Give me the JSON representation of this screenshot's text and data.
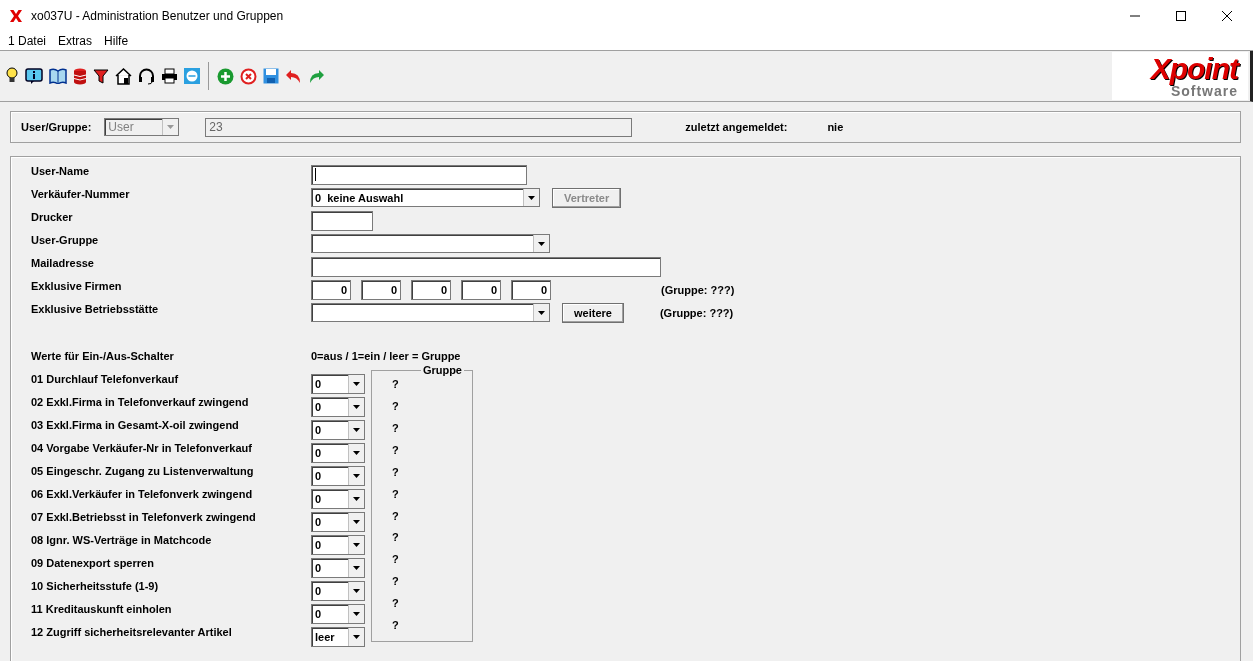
{
  "window": {
    "title": "xo037U - Administration Benutzer und Gruppen"
  },
  "menu": [
    "1 Datei",
    "Extras",
    "Hilfe"
  ],
  "logo": {
    "brand": "Xpoint",
    "sub": "Software"
  },
  "header": {
    "label": "User/Gruppe:",
    "type": {
      "value": "User",
      "disabled": true
    },
    "id": "23",
    "login_label": "zuletzt angemeldet:",
    "login_value": "nie"
  },
  "fields": [
    {
      "label": "User-Name",
      "kind": "name"
    },
    {
      "label": "Verkäufer-Nummer",
      "kind": "select-button",
      "value": "0  keine Auswahl",
      "button": {
        "label": "Vertreter",
        "disabled": true
      }
    },
    {
      "label": "Drucker",
      "kind": "short"
    },
    {
      "label": "User-Gruppe",
      "kind": "select"
    },
    {
      "label": "Mailadresse",
      "kind": "mail"
    },
    {
      "label": "Exklusive Firmen",
      "kind": "numbers",
      "values": [
        "0",
        "0",
        "0",
        "0",
        "0"
      ],
      "note": "(Gruppe:  ???)"
    },
    {
      "label": "Exklusive Betriebsstätte",
      "kind": "select-button",
      "button": {
        "label": "weitere",
        "disabled": false
      },
      "note": "(Gruppe:  ???)"
    }
  ],
  "switches": {
    "title": "Werte für Ein-/Aus-Schalter",
    "legend": "0=aus / 1=ein / leer = Gruppe",
    "group_title": "Gruppe",
    "items": [
      {
        "label": "01 Durchlauf Telefonverkauf",
        "value": "0",
        "group": "?"
      },
      {
        "label": "02 Exkl.Firma in Telefonverkauf zwingend",
        "value": "0",
        "group": "?"
      },
      {
        "label": "03 Exkl.Firma in Gesamt-X-oil zwingend",
        "value": "0",
        "group": "?"
      },
      {
        "label": "04 Vorgabe Verkäufer-Nr in Telefonverkauf",
        "value": "0",
        "group": "?"
      },
      {
        "label": "05 Eingeschr. Zugang zu Listenverwaltung",
        "value": "0",
        "group": "?"
      },
      {
        "label": "06 Exkl.Verkäufer in Telefonverk zwingend",
        "value": "0",
        "group": "?"
      },
      {
        "label": "07 Exkl.Betriebsst in Telefonverk zwingend",
        "value": "0",
        "group": "?"
      },
      {
        "label": "08 Ignr. WS-Verträge in Matchcode",
        "value": "0",
        "group": "?"
      },
      {
        "label": "09 Datenexport sperren",
        "value": "0",
        "group": "?"
      },
      {
        "label": "10 Sicherheitsstufe (1-9)",
        "value": "0",
        "group": "?"
      },
      {
        "label": "11 Kreditauskunft einholen",
        "value": "0",
        "group": "?"
      },
      {
        "label": "12 Zugriff sicherheitsrelevanter Artikel",
        "value": "leer",
        "group": "?"
      }
    ]
  }
}
